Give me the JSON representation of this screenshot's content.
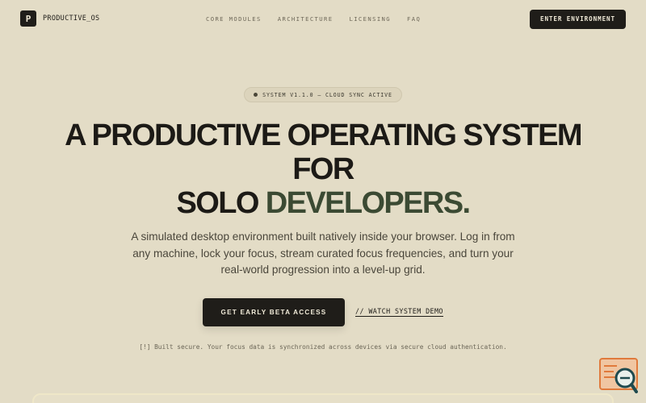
{
  "nav": {
    "logo_letter": "P",
    "brand": "PRODUCTIVE_OS",
    "links": [
      "CORE MODULES",
      "ARCHITECTURE",
      "LICENSING",
      "FAQ"
    ],
    "cta": "ENTER ENVIRONMENT"
  },
  "hero": {
    "badge": "SYSTEM V1.1.0 — CLOUD SYNC ACTIVE",
    "headline_line1": "A PRODUCTIVE OPERATING SYSTEM",
    "headline_line2": "FOR",
    "headline_line3_a": "SOLO ",
    "headline_line3_b": "DEVELOPERS.",
    "subtext": "A simulated desktop environment built natively inside your browser. Log in from any machine, lock your focus, stream curated focus frequencies, and turn your real-world progression into a level-up grid.",
    "primary_cta": "GET EARLY BETA ACCESS",
    "secondary_cta": "// WATCH SYSTEM DEMO",
    "footnote": "[!] Built secure. Your focus data is synchronized across devices via secure cloud authentication."
  },
  "colors": {
    "background": "#e3dcc6",
    "ink": "#1c1a16",
    "accent": "#3b4a33",
    "widget_orange": "#e07a3c",
    "widget_teal": "#1f4a4f"
  },
  "icons": {
    "widget": "search-chat-widget-icon"
  }
}
